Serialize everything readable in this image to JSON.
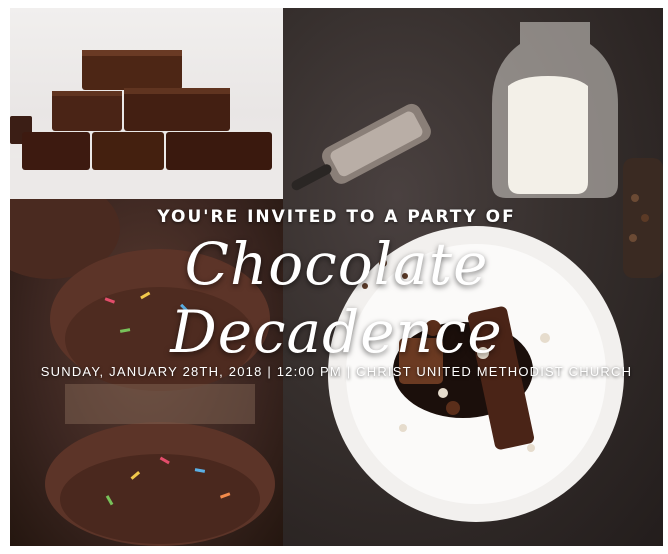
{
  "invitation": {
    "intro": "YOU'RE INVITED TO A PARTY OF",
    "headline": "Chocolate Decadence",
    "details": "SUNDAY, JANUARY 28TH, 2018 | 12:00 PM | CHRIST UNITED METHODIST CHURCH"
  },
  "colors": {
    "text": "#ffffff",
    "background_dark": "#2b2523",
    "chocolate": "#4a2418",
    "milk": "#f3f0e8"
  }
}
